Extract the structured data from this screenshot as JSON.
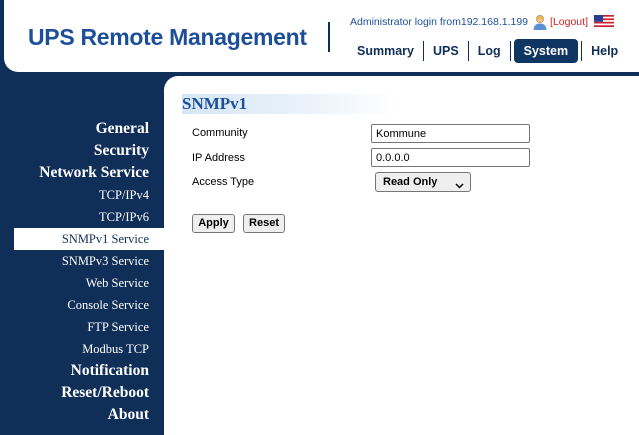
{
  "header": {
    "brand": "UPS Remote Management",
    "login_text": "Administrator login from192.168.1.199",
    "logout_label": "Logout",
    "nav": [
      {
        "label": "Summary"
      },
      {
        "label": "UPS"
      },
      {
        "label": "Log"
      },
      {
        "label": "System",
        "active": true
      },
      {
        "label": "Help"
      }
    ],
    "flag_icon": "us-flag-icon",
    "user_icon": "user-icon"
  },
  "sidebar": {
    "items": [
      {
        "label": "General",
        "level": "main"
      },
      {
        "label": "Security",
        "level": "main"
      },
      {
        "label": "Network Service",
        "level": "main"
      },
      {
        "label": "TCP/IPv4",
        "level": "sub"
      },
      {
        "label": "TCP/IPv6",
        "level": "sub"
      },
      {
        "label": "SNMPv1 Service",
        "level": "sub",
        "active": true
      },
      {
        "label": "SNMPv3 Service",
        "level": "sub"
      },
      {
        "label": "Web Service",
        "level": "sub"
      },
      {
        "label": "Console Service",
        "level": "sub"
      },
      {
        "label": "FTP Service",
        "level": "sub"
      },
      {
        "label": "Modbus TCP",
        "level": "sub"
      },
      {
        "label": "Notification",
        "level": "main"
      },
      {
        "label": "Reset/Reboot",
        "level": "main"
      },
      {
        "label": "About",
        "level": "main"
      }
    ]
  },
  "main": {
    "title": "SNMPv1",
    "community_label": "Community",
    "community_value": "Kommune",
    "ip_label": "IP Address",
    "ip_value": "0.0.0.0",
    "access_label": "Access Type",
    "access_value": "Read Only",
    "apply_label": "Apply",
    "reset_label": "Reset"
  },
  "colors": {
    "navy": "#0f2e58",
    "brand_blue": "#1d4f99",
    "logout_red": "#cc1f1f"
  }
}
